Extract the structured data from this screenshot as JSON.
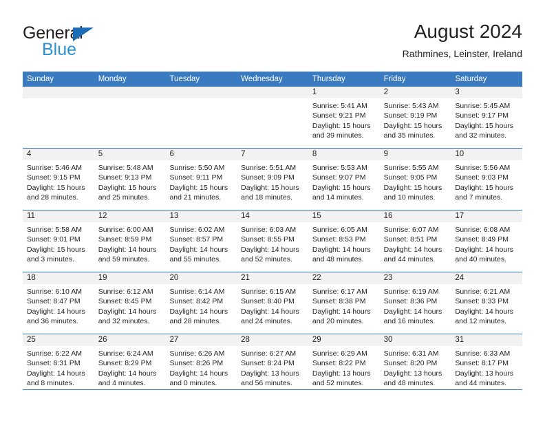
{
  "brand": {
    "name_part1": "General",
    "name_part2": "Blue",
    "triangle_icon": "triangle-icon",
    "color_dark": "#231f20",
    "color_blue": "#2a8fd4",
    "color_triangle": "#1b6cb5"
  },
  "header": {
    "title": "August 2024",
    "subtitle": "Rathmines, Leinster, Ireland"
  },
  "theme": {
    "header_row_bg": "#3a7ac0",
    "day_number_bg": "#f2f2f2",
    "grid_line": "#3a7ac0",
    "text": "#231f20"
  },
  "calendar": {
    "weekday_headers": [
      "Sunday",
      "Monday",
      "Tuesday",
      "Wednesday",
      "Thursday",
      "Friday",
      "Saturday"
    ],
    "weeks": [
      [
        {
          "day": "",
          "empty": true,
          "lines": []
        },
        {
          "day": "",
          "empty": true,
          "lines": []
        },
        {
          "day": "",
          "empty": true,
          "lines": []
        },
        {
          "day": "",
          "empty": true,
          "lines": []
        },
        {
          "day": "1",
          "empty": false,
          "lines": [
            "Sunrise: 5:41 AM",
            "Sunset: 9:21 PM",
            "Daylight: 15 hours",
            "and 39 minutes."
          ]
        },
        {
          "day": "2",
          "empty": false,
          "lines": [
            "Sunrise: 5:43 AM",
            "Sunset: 9:19 PM",
            "Daylight: 15 hours",
            "and 35 minutes."
          ]
        },
        {
          "day": "3",
          "empty": false,
          "lines": [
            "Sunrise: 5:45 AM",
            "Sunset: 9:17 PM",
            "Daylight: 15 hours",
            "and 32 minutes."
          ]
        }
      ],
      [
        {
          "day": "4",
          "empty": false,
          "lines": [
            "Sunrise: 5:46 AM",
            "Sunset: 9:15 PM",
            "Daylight: 15 hours",
            "and 28 minutes."
          ]
        },
        {
          "day": "5",
          "empty": false,
          "lines": [
            "Sunrise: 5:48 AM",
            "Sunset: 9:13 PM",
            "Daylight: 15 hours",
            "and 25 minutes."
          ]
        },
        {
          "day": "6",
          "empty": false,
          "lines": [
            "Sunrise: 5:50 AM",
            "Sunset: 9:11 PM",
            "Daylight: 15 hours",
            "and 21 minutes."
          ]
        },
        {
          "day": "7",
          "empty": false,
          "lines": [
            "Sunrise: 5:51 AM",
            "Sunset: 9:09 PM",
            "Daylight: 15 hours",
            "and 18 minutes."
          ]
        },
        {
          "day": "8",
          "empty": false,
          "lines": [
            "Sunrise: 5:53 AM",
            "Sunset: 9:07 PM",
            "Daylight: 15 hours",
            "and 14 minutes."
          ]
        },
        {
          "day": "9",
          "empty": false,
          "lines": [
            "Sunrise: 5:55 AM",
            "Sunset: 9:05 PM",
            "Daylight: 15 hours",
            "and 10 minutes."
          ]
        },
        {
          "day": "10",
          "empty": false,
          "lines": [
            "Sunrise: 5:56 AM",
            "Sunset: 9:03 PM",
            "Daylight: 15 hours",
            "and 7 minutes."
          ]
        }
      ],
      [
        {
          "day": "11",
          "empty": false,
          "lines": [
            "Sunrise: 5:58 AM",
            "Sunset: 9:01 PM",
            "Daylight: 15 hours",
            "and 3 minutes."
          ]
        },
        {
          "day": "12",
          "empty": false,
          "lines": [
            "Sunrise: 6:00 AM",
            "Sunset: 8:59 PM",
            "Daylight: 14 hours",
            "and 59 minutes."
          ]
        },
        {
          "day": "13",
          "empty": false,
          "lines": [
            "Sunrise: 6:02 AM",
            "Sunset: 8:57 PM",
            "Daylight: 14 hours",
            "and 55 minutes."
          ]
        },
        {
          "day": "14",
          "empty": false,
          "lines": [
            "Sunrise: 6:03 AM",
            "Sunset: 8:55 PM",
            "Daylight: 14 hours",
            "and 52 minutes."
          ]
        },
        {
          "day": "15",
          "empty": false,
          "lines": [
            "Sunrise: 6:05 AM",
            "Sunset: 8:53 PM",
            "Daylight: 14 hours",
            "and 48 minutes."
          ]
        },
        {
          "day": "16",
          "empty": false,
          "lines": [
            "Sunrise: 6:07 AM",
            "Sunset: 8:51 PM",
            "Daylight: 14 hours",
            "and 44 minutes."
          ]
        },
        {
          "day": "17",
          "empty": false,
          "lines": [
            "Sunrise: 6:08 AM",
            "Sunset: 8:49 PM",
            "Daylight: 14 hours",
            "and 40 minutes."
          ]
        }
      ],
      [
        {
          "day": "18",
          "empty": false,
          "lines": [
            "Sunrise: 6:10 AM",
            "Sunset: 8:47 PM",
            "Daylight: 14 hours",
            "and 36 minutes."
          ]
        },
        {
          "day": "19",
          "empty": false,
          "lines": [
            "Sunrise: 6:12 AM",
            "Sunset: 8:45 PM",
            "Daylight: 14 hours",
            "and 32 minutes."
          ]
        },
        {
          "day": "20",
          "empty": false,
          "lines": [
            "Sunrise: 6:14 AM",
            "Sunset: 8:42 PM",
            "Daylight: 14 hours",
            "and 28 minutes."
          ]
        },
        {
          "day": "21",
          "empty": false,
          "lines": [
            "Sunrise: 6:15 AM",
            "Sunset: 8:40 PM",
            "Daylight: 14 hours",
            "and 24 minutes."
          ]
        },
        {
          "day": "22",
          "empty": false,
          "lines": [
            "Sunrise: 6:17 AM",
            "Sunset: 8:38 PM",
            "Daylight: 14 hours",
            "and 20 minutes."
          ]
        },
        {
          "day": "23",
          "empty": false,
          "lines": [
            "Sunrise: 6:19 AM",
            "Sunset: 8:36 PM",
            "Daylight: 14 hours",
            "and 16 minutes."
          ]
        },
        {
          "day": "24",
          "empty": false,
          "lines": [
            "Sunrise: 6:21 AM",
            "Sunset: 8:33 PM",
            "Daylight: 14 hours",
            "and 12 minutes."
          ]
        }
      ],
      [
        {
          "day": "25",
          "empty": false,
          "lines": [
            "Sunrise: 6:22 AM",
            "Sunset: 8:31 PM",
            "Daylight: 14 hours",
            "and 8 minutes."
          ]
        },
        {
          "day": "26",
          "empty": false,
          "lines": [
            "Sunrise: 6:24 AM",
            "Sunset: 8:29 PM",
            "Daylight: 14 hours",
            "and 4 minutes."
          ]
        },
        {
          "day": "27",
          "empty": false,
          "lines": [
            "Sunrise: 6:26 AM",
            "Sunset: 8:26 PM",
            "Daylight: 14 hours",
            "and 0 minutes."
          ]
        },
        {
          "day": "28",
          "empty": false,
          "lines": [
            "Sunrise: 6:27 AM",
            "Sunset: 8:24 PM",
            "Daylight: 13 hours",
            "and 56 minutes."
          ]
        },
        {
          "day": "29",
          "empty": false,
          "lines": [
            "Sunrise: 6:29 AM",
            "Sunset: 8:22 PM",
            "Daylight: 13 hours",
            "and 52 minutes."
          ]
        },
        {
          "day": "30",
          "empty": false,
          "lines": [
            "Sunrise: 6:31 AM",
            "Sunset: 8:20 PM",
            "Daylight: 13 hours",
            "and 48 minutes."
          ]
        },
        {
          "day": "31",
          "empty": false,
          "lines": [
            "Sunrise: 6:33 AM",
            "Sunset: 8:17 PM",
            "Daylight: 13 hours",
            "and 44 minutes."
          ]
        }
      ]
    ]
  }
}
